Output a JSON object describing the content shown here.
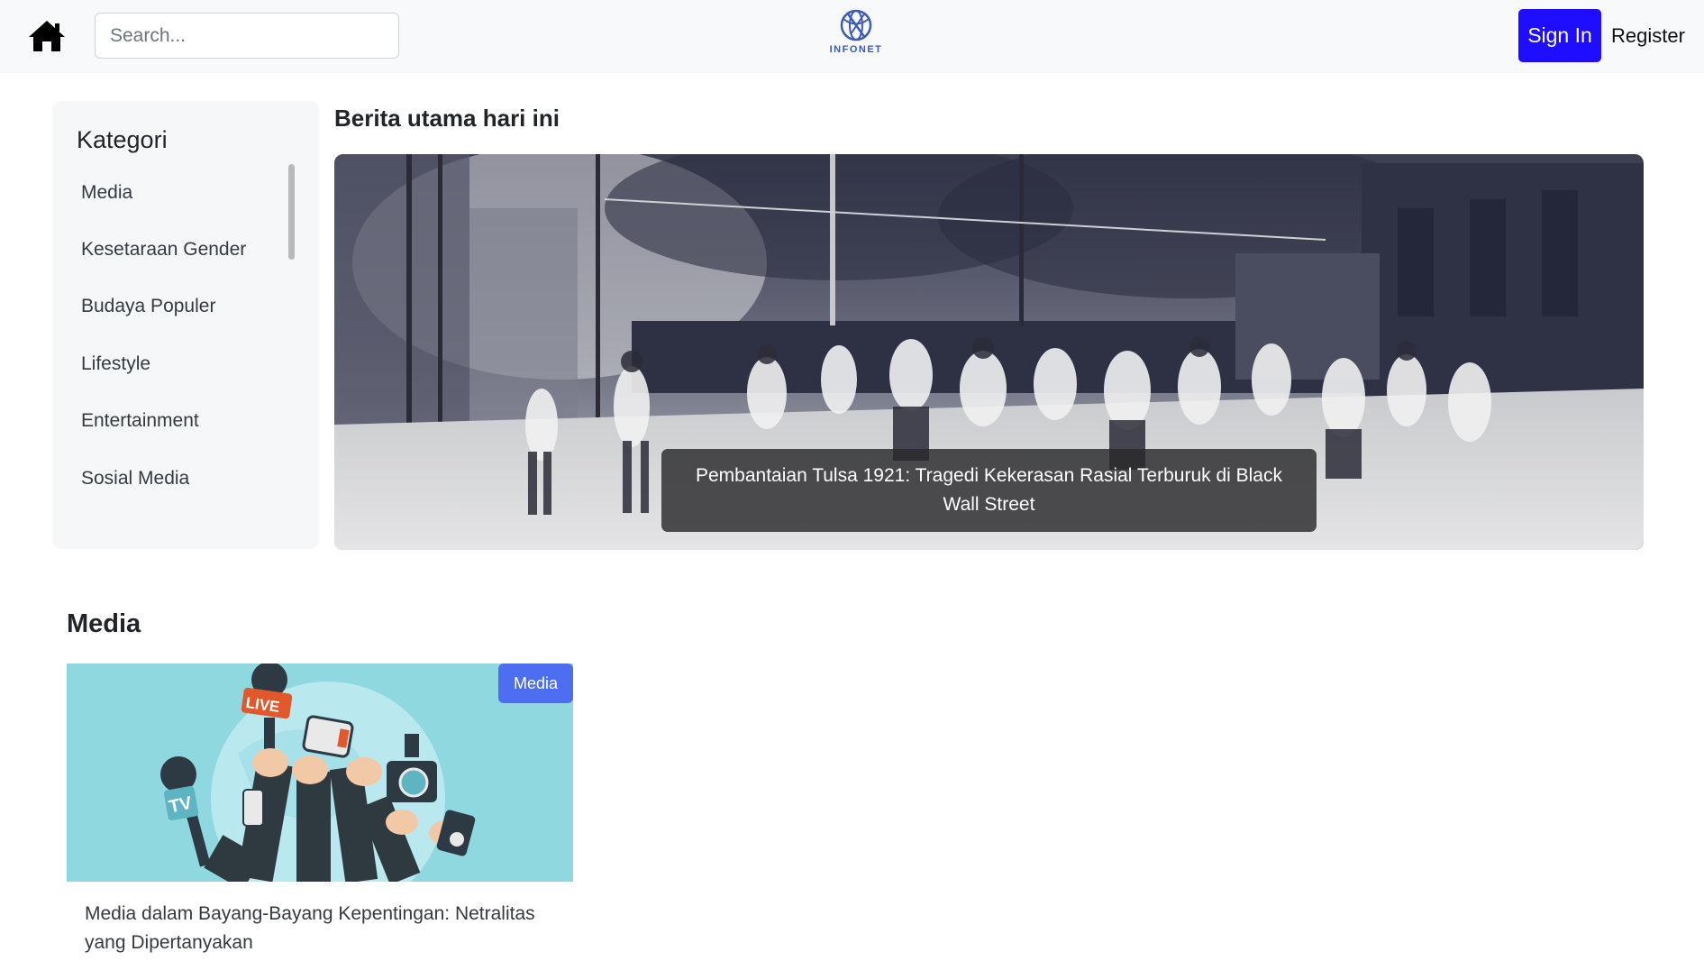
{
  "header": {
    "search_placeholder": "Search...",
    "logo_text": "INFONET",
    "signin_label": "Sign In",
    "register_label": "Register"
  },
  "sidebar": {
    "title": "Kategori",
    "items": [
      {
        "label": "Media"
      },
      {
        "label": "Kesetaraan Gender"
      },
      {
        "label": "Budaya Populer"
      },
      {
        "label": "Lifestyle"
      },
      {
        "label": "Entertainment"
      },
      {
        "label": "Sosial Media"
      }
    ]
  },
  "headline": {
    "heading": "Berita utama hari ini",
    "caption": "Pembantaian Tulsa 1921: Tragedi Kekerasan Rasial Terburuk di Black Wall Street"
  },
  "media_section": {
    "heading": "Media",
    "cards": [
      {
        "badge": "Media",
        "title": "Media dalam Bayang-Bayang Kepentingan: Netralitas yang Dipertanyakan",
        "live_text": "LIVE",
        "tv_text": "TV"
      }
    ]
  },
  "colors": {
    "primary_button": "#1e0dff",
    "badge": "#4e6ef2",
    "navbar_bg": "#f8f9fa",
    "card_image_bg": "#8fd8e0"
  }
}
